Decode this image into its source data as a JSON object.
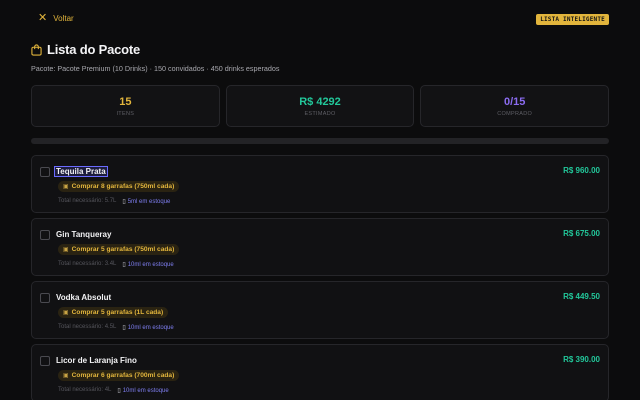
{
  "topbar": {
    "back_label": "Voltar",
    "badge": "LISTA INTELIGENTE"
  },
  "header": {
    "title": "Lista do Pacote",
    "subtitle": "Pacote: Pacote Premium (10 Drinks) · 150 convidados · 450 drinks esperados"
  },
  "stats": [
    {
      "value": "15",
      "label": "ITENS",
      "color": "#e2b53c"
    },
    {
      "value": "R$ 4292",
      "label": "ESTIMADO",
      "color": "#22c79a"
    },
    {
      "value": "0/15",
      "label": "COMPRADO",
      "color": "#8b6cf0"
    }
  ],
  "progress_fraction": 0,
  "items": [
    {
      "name": "Tequila Prata",
      "price": "R$ 960.00",
      "buy": "Comprar 8 garrafas (750ml cada)",
      "total": "Total necessário: 5.7L",
      "stock": "5ml em estoque"
    },
    {
      "name": "Gin Tanqueray",
      "price": "R$ 675.00",
      "buy": "Comprar 5 garrafas (750ml cada)",
      "total": "Total necessário: 3.4L",
      "stock": "10ml em estoque"
    },
    {
      "name": "Vodka Absolut",
      "price": "R$ 449.50",
      "buy": "Comprar 5 garrafas (1L cada)",
      "total": "Total necessário: 4.5L",
      "stock": "10ml em estoque"
    },
    {
      "name": "Licor de Laranja Fino",
      "price": "R$ 390.00",
      "buy": "Comprar 6 garrafas (700ml cada)",
      "total": "Total necessário: 4L",
      "stock": "10ml em estoque"
    }
  ]
}
